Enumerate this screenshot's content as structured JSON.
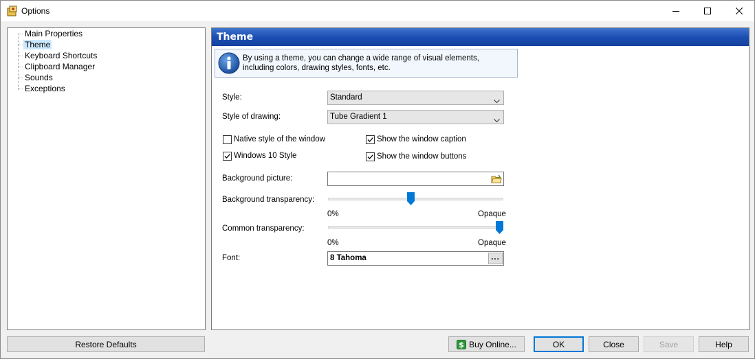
{
  "window": {
    "title": "Options",
    "minimize_icon": "minimize-icon",
    "maximize_icon": "maximize-icon",
    "close_icon": "close-icon"
  },
  "tree": {
    "items": [
      {
        "label": "Main Properties",
        "selected": false
      },
      {
        "label": "Theme",
        "selected": true
      },
      {
        "label": "Keyboard Shortcuts",
        "selected": false
      },
      {
        "label": "Clipboard Manager",
        "selected": false
      },
      {
        "label": "Sounds",
        "selected": false
      },
      {
        "label": "Exceptions",
        "selected": false
      }
    ]
  },
  "panel": {
    "title": "Theme",
    "info_text": "By using a theme, you can change a wide range of visual elements, including colors, drawing styles, fonts, etc.",
    "style_label": "Style:",
    "style_value": "Standard",
    "drawing_label": "Style of drawing:",
    "drawing_value": "Tube Gradient 1",
    "checkboxes": {
      "native_style": {
        "label": "Native style of the window",
        "checked": false
      },
      "windows10": {
        "label": "Windows 10 Style",
        "checked": true
      },
      "show_caption": {
        "label": "Show the window caption",
        "checked": true
      },
      "show_buttons": {
        "label": "Show the window buttons",
        "checked": true
      }
    },
    "bg_picture_label": "Background picture:",
    "bg_picture_value": "",
    "bg_transparency_label": "Background transparency:",
    "bg_transparency_level": 0.47,
    "common_transparency_label": "Common transparency:",
    "common_transparency_level": 1.0,
    "slider_min_label": "0%",
    "slider_max_label": "Opaque",
    "font_label": "Font:",
    "font_value": "8 Tahoma",
    "font_button": "..."
  },
  "buttons": {
    "restore_defaults": "Restore Defaults",
    "buy_online": "Buy Online...",
    "ok": "OK",
    "close": "Close",
    "save": "Save",
    "help": "Help"
  },
  "colors": {
    "header_blue": "#1c4fb3",
    "selection": "#cce8ff",
    "slider_thumb": "#0078d7"
  }
}
